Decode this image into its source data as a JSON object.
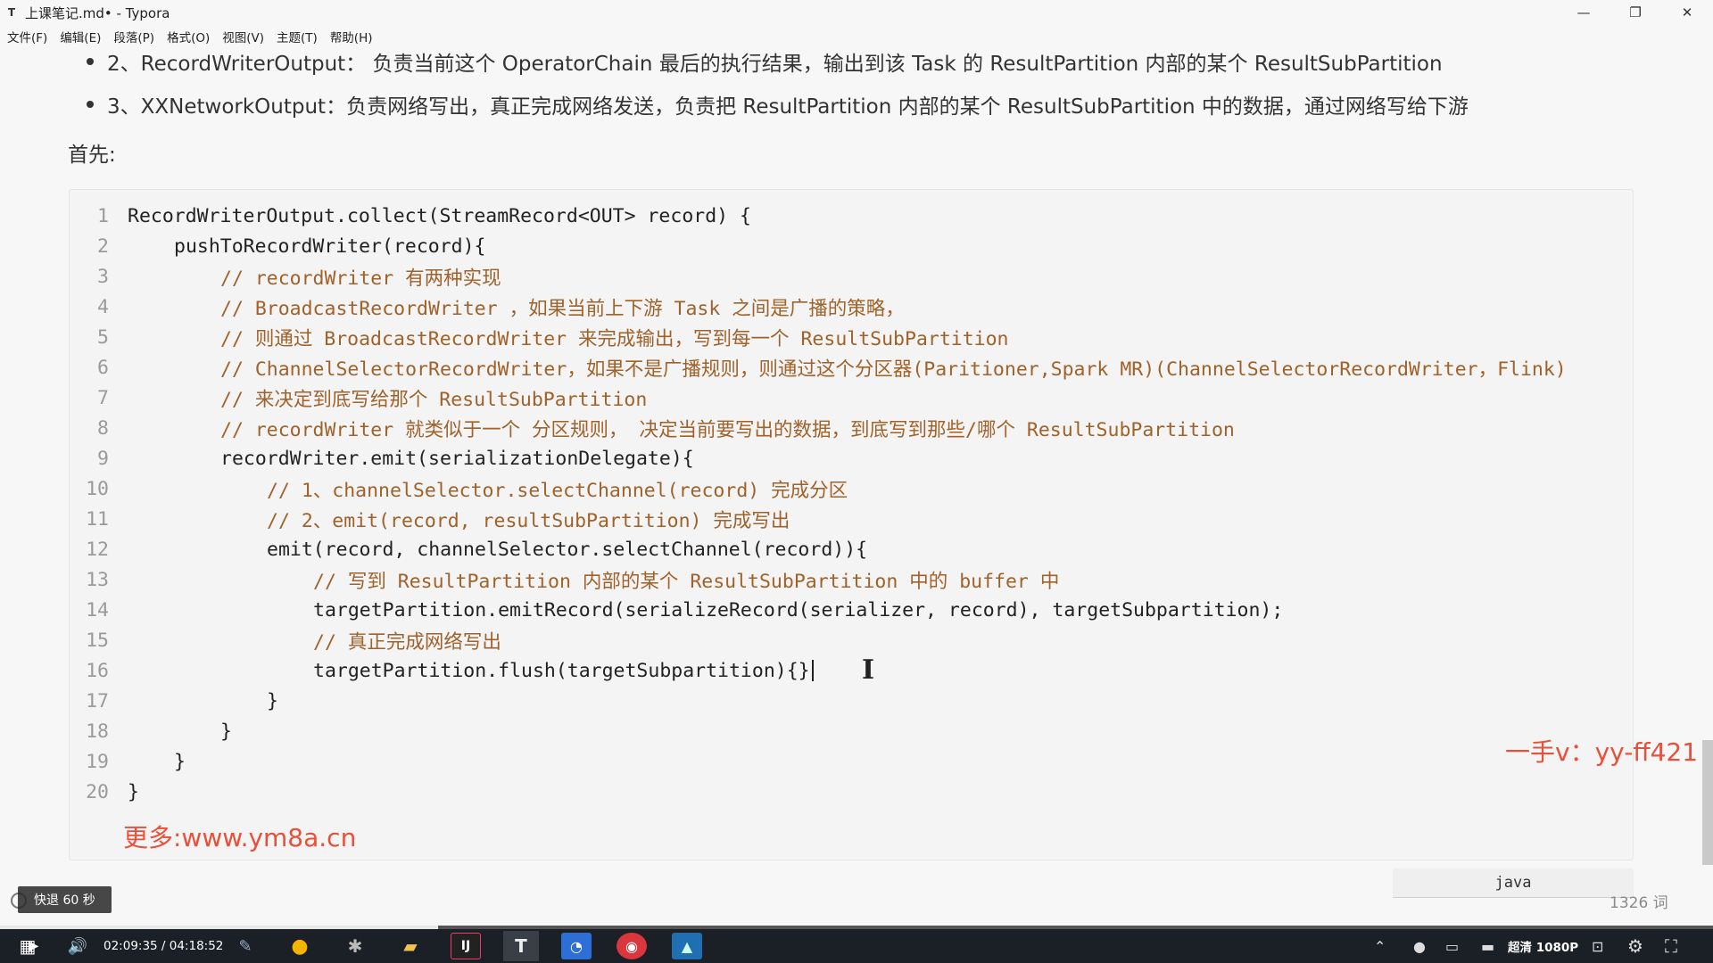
{
  "window": {
    "title": "上课笔记.md• - Typora",
    "app_icon": "T",
    "controls": {
      "minimize": "—",
      "restore": "❐",
      "close": "✕"
    }
  },
  "menu": [
    "文件(F)",
    "编辑(E)",
    "段落(P)",
    "格式(O)",
    "视图(V)",
    "主题(T)",
    "帮助(H)"
  ],
  "doc": {
    "bullets": [
      "2、RecordWriterOutput： 负责当前这个 OperatorChain 最后的执行结果，输出到该 Task 的 ResultPartition 内部的某个 ResultSubPartition",
      "3、XXNetworkOutput：负责网络写出，真正完成网络发送，负责把 ResultPartition 内部的某个 ResultSubPartition 中的数据，通过网络写给下游"
    ],
    "paragraph": "首先:",
    "code_language": "java",
    "code_lines": [
      {
        "no": "1",
        "indent": 0,
        "text": "RecordWriterOutput.collect(StreamRecord<OUT> record) {",
        "comment": false
      },
      {
        "no": "2",
        "indent": 1,
        "text": "pushToRecordWriter(record){",
        "comment": false
      },
      {
        "no": "3",
        "indent": 2,
        "text": "// recordWriter 有两种实现",
        "comment": true
      },
      {
        "no": "4",
        "indent": 2,
        "text": "// BroadcastRecordWriter ，如果当前上下游 Task 之间是广播的策略，",
        "comment": true
      },
      {
        "no": "5",
        "indent": 2,
        "text": "// 则通过 BroadcastRecordWriter 来完成输出，写到每一个 ResultSubPartition",
        "comment": true
      },
      {
        "no": "6",
        "indent": 2,
        "text": "// ChannelSelectorRecordWriter，如果不是广播规则，则通过这个分区器(Paritioner,Spark MR)(ChannelSelectorRecordWriter，Flink)",
        "comment": true
      },
      {
        "no": "7",
        "indent": 2,
        "text": "// 来决定到底写给那个 ResultSubPartition",
        "comment": true
      },
      {
        "no": "8",
        "indent": 2,
        "text": "// recordWriter 就类似于一个 分区规则， 决定当前要写出的数据，到底写到那些/哪个 ResultSubPartition",
        "comment": true
      },
      {
        "no": "9",
        "indent": 2,
        "text": "recordWriter.emit(serializationDelegate){",
        "comment": false
      },
      {
        "no": "10",
        "indent": 3,
        "text": "// 1、channelSelector.selectChannel(record) 完成分区",
        "comment": true
      },
      {
        "no": "11",
        "indent": 3,
        "text": "// 2、emit(record, resultSubPartition) 完成写出",
        "comment": true
      },
      {
        "no": "12",
        "indent": 3,
        "text": "emit(record, channelSelector.selectChannel(record)){",
        "comment": false
      },
      {
        "no": "13",
        "indent": 4,
        "text": "// 写到 ResultPartition 内部的某个 ResultSubPartition 中的 buffer 中",
        "comment": true
      },
      {
        "no": "14",
        "indent": 4,
        "text": "targetPartition.emitRecord(serializeRecord(serializer, record), targetSubpartition);",
        "comment": false
      },
      {
        "no": "15",
        "indent": 4,
        "text": "// 真正完成网络写出",
        "comment": true
      },
      {
        "no": "16",
        "indent": 4,
        "text": "targetPartition.flush(targetSubpartition){}",
        "comment": false
      },
      {
        "no": "17",
        "indent": 3,
        "text": "}",
        "comment": false
      },
      {
        "no": "18",
        "indent": 2,
        "text": "}",
        "comment": false
      },
      {
        "no": "19",
        "indent": 1,
        "text": "}",
        "comment": false
      },
      {
        "no": "20",
        "indent": 0,
        "text": "}",
        "comment": false
      }
    ],
    "word_count": "1326 词"
  },
  "watermarks": {
    "contact": "一手v：yy-ff421",
    "site": "更多:www.ym8a.cn"
  },
  "player": {
    "rewind_label": "快退 60 秒",
    "time": "02:09:35 / 04:18:52",
    "progress": 0.5,
    "resolution": "超清 1080P"
  },
  "colors": {
    "comment": "#a0622a",
    "watermark": "#e8503a",
    "taskbar": "#1b1f26"
  }
}
